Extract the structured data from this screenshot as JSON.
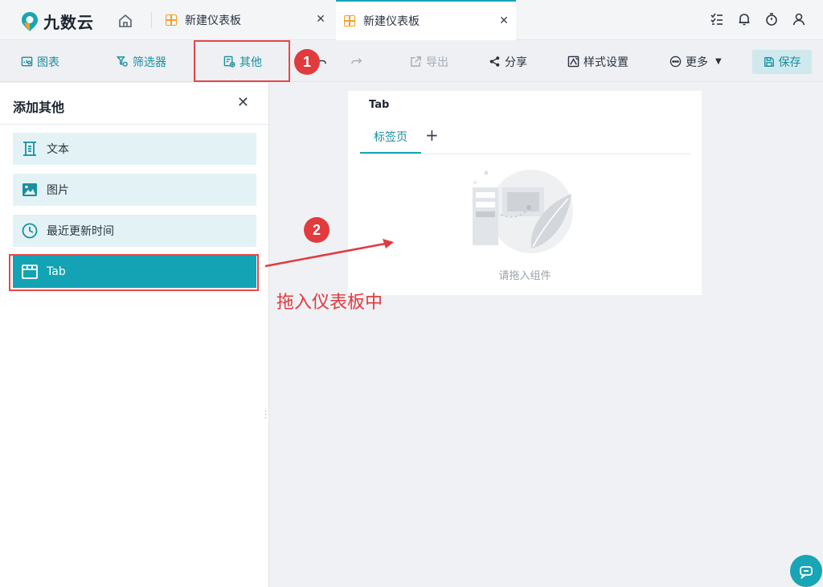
{
  "logo": {
    "text": "九数云"
  },
  "tabs": [
    {
      "label": "新建仪表板",
      "active": false
    },
    {
      "label": "新建仪表板",
      "active": true
    }
  ],
  "toolbar": {
    "chart": "图表",
    "filter": "筛选器",
    "other": "其他",
    "export": "导出",
    "share": "分享",
    "style": "样式设置",
    "more": "更多",
    "save": "保存"
  },
  "panel": {
    "title": "添加其他",
    "items": [
      {
        "label": "文本",
        "icon": "text-icon"
      },
      {
        "label": "图片",
        "icon": "image-icon"
      },
      {
        "label": "最近更新时间",
        "icon": "clock-icon"
      },
      {
        "label": "Tab",
        "icon": "tab-icon"
      }
    ]
  },
  "card": {
    "title": "Tab",
    "tab_label": "标签页",
    "empty_text": "请拖入组件"
  },
  "annotations": {
    "step1": "1",
    "step2": "2",
    "drag_hint": "拖入仪表板中"
  },
  "colors": {
    "accent": "#18a5b5",
    "annotation": "#e03b3f",
    "tab_icon": "#f0a028"
  }
}
